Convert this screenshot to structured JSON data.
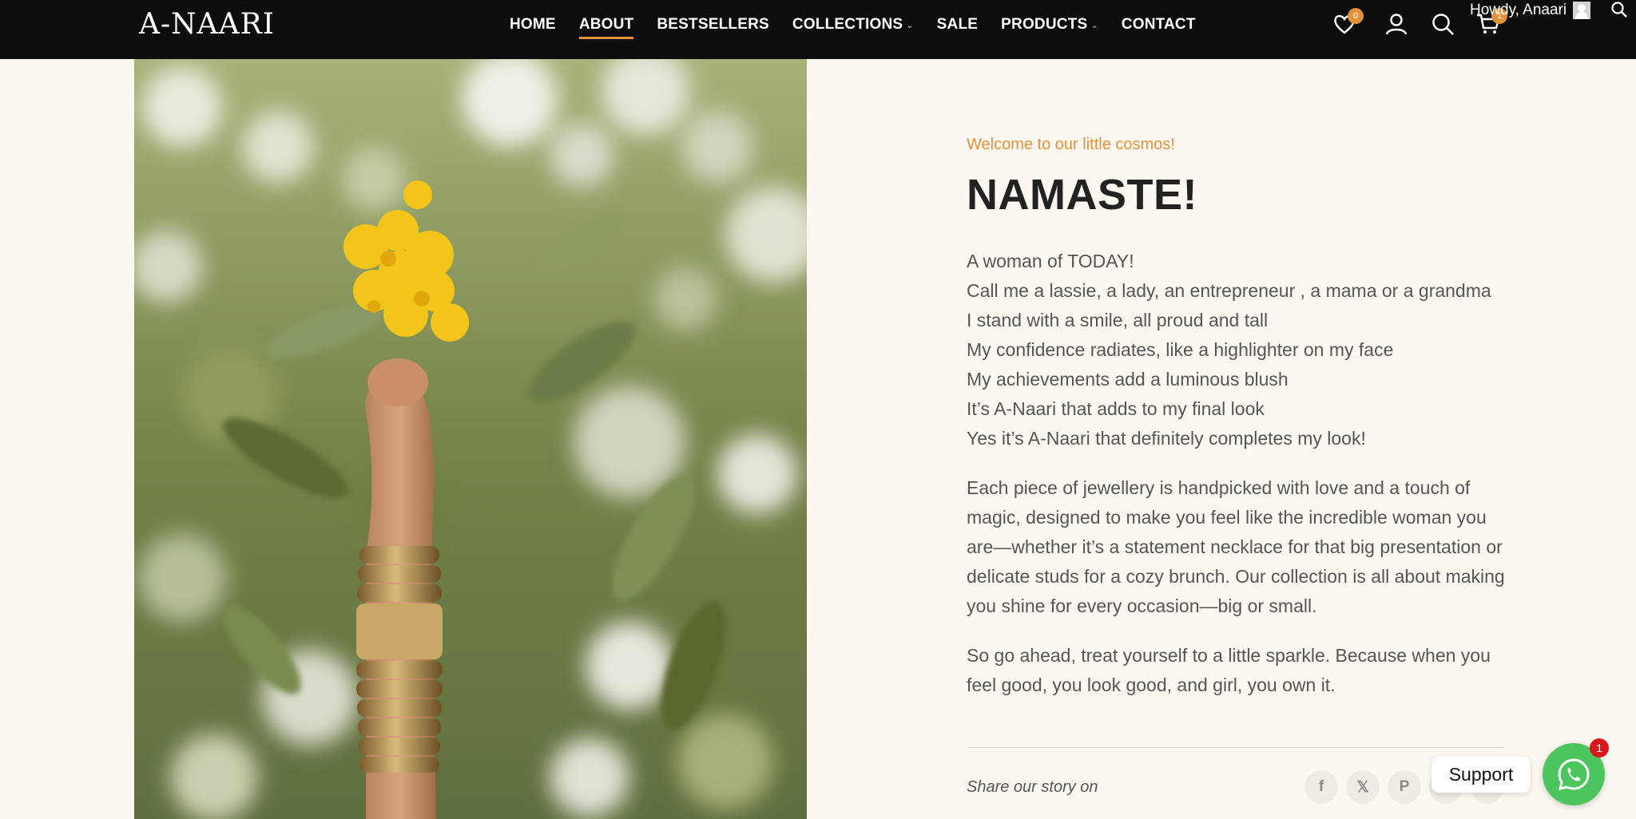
{
  "header": {
    "logo": "A-NAARI",
    "nav": [
      {
        "label": "HOME"
      },
      {
        "label": "ABOUT",
        "active": true
      },
      {
        "label": "BESTSELLERS"
      },
      {
        "label": "COLLECTIONS",
        "dropdown": true
      },
      {
        "label": "SALE"
      },
      {
        "label": "PRODUCTS",
        "dropdown": true
      },
      {
        "label": "CONTACT"
      }
    ],
    "wishlist_count": "0",
    "cart_count": "1",
    "howdy": "Howdy, Anaari",
    "icons": [
      "heart-icon",
      "user-icon",
      "search-icon",
      "cart-icon"
    ]
  },
  "about": {
    "eyebrow": "Welcome to our little cosmos!",
    "title": "NAMASTE!",
    "poem": [
      "A woman of TODAY!",
      "Call me a lassie, a lady, an entrepreneur , a mama or a grandma",
      "I stand with a smile, all proud and tall",
      "My confidence radiates, like a highlighter on my face",
      "My achievements add a luminous blush",
      "It’s A-Naari that adds to my final look",
      "Yes it’s A-Naari that definitely completes my look!"
    ],
    "paragraph1": "Each piece of jewellery is handpicked with love and a touch of magic, designed to make you feel like the incredible woman you are—whether it’s a statement necklace for that big presentation or delicate studs for a cozy brunch. Our collection is all about making you shine for every occasion—big or small.",
    "paragraph2": "So go ahead, treat yourself to a little sparkle. Because when you feel good, you look good, and girl, you own it.",
    "share_label": "Share our story on",
    "share_icons": [
      "facebook-icon",
      "x-icon",
      "pinterest-icon",
      "linkedin-icon",
      "telegram-icon"
    ]
  },
  "support": {
    "label": "Support",
    "badge": "1"
  },
  "colors": {
    "accent": "#e0913a",
    "header_bg": "#0d0d0d",
    "page_bg": "#fcf8f1",
    "whatsapp": "#4dc55f"
  }
}
